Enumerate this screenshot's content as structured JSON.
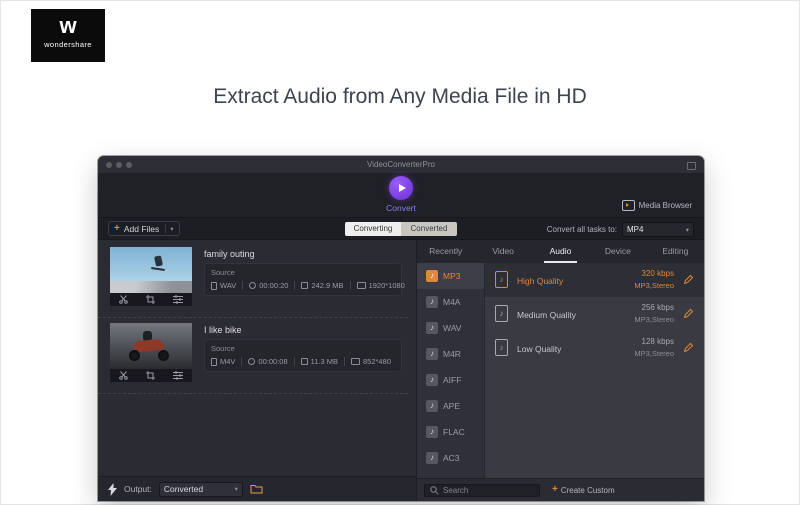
{
  "header": {
    "logo_mark": "w",
    "logo_brand": "wondershare",
    "heading": "Extract Audio from Any Media File in HD"
  },
  "app": {
    "titlebar": {
      "title": "VideoConverterPro"
    },
    "nav": {
      "convert": "Convert",
      "media_browser": "Media Browser"
    },
    "toolbar": {
      "add_files": "Add Files",
      "tab_converting": "Converting",
      "tab_converted": "Converted",
      "convert_all": "Convert all tasks to:",
      "target_format": "MP4"
    },
    "videos": [
      {
        "title": "family outing",
        "source_label": "Source",
        "format": "WAV",
        "duration": "00:00:20",
        "size": "242.9 MB",
        "resolution": "1920*1080"
      },
      {
        "title": "I like bike",
        "source_label": "Source",
        "format": "M4V",
        "duration": "00:00:08",
        "size": "11.3 MB",
        "resolution": "852*480"
      }
    ],
    "panel": {
      "tabs": [
        "Recently",
        "Video",
        "Audio",
        "Device",
        "Editing"
      ],
      "active_tab": "Audio",
      "formats": [
        "MP3",
        "M4A",
        "WAV",
        "M4R",
        "AIFF",
        "APE",
        "FLAC",
        "AC3"
      ],
      "active_format": "MP3",
      "qualities": [
        {
          "name": "High Quality",
          "bitrate": "320 kbps",
          "detail": "MP3,Stereo"
        },
        {
          "name": "Medium Quality",
          "bitrate": "256 kbps",
          "detail": "MP3,Stereo"
        },
        {
          "name": "Low Quality",
          "bitrate": "128 kbps",
          "detail": "MP3,Stereo"
        }
      ],
      "search": "Search",
      "create_custom": "Create Custom"
    },
    "footer": {
      "output": "Output:",
      "output_value": "Converted"
    }
  },
  "icons": {
    "plus": "+",
    "caret_down": "▾",
    "note": "♪"
  },
  "colors": {
    "accent_orange": "#e0883a",
    "accent_purple": "#6d2fd6"
  }
}
